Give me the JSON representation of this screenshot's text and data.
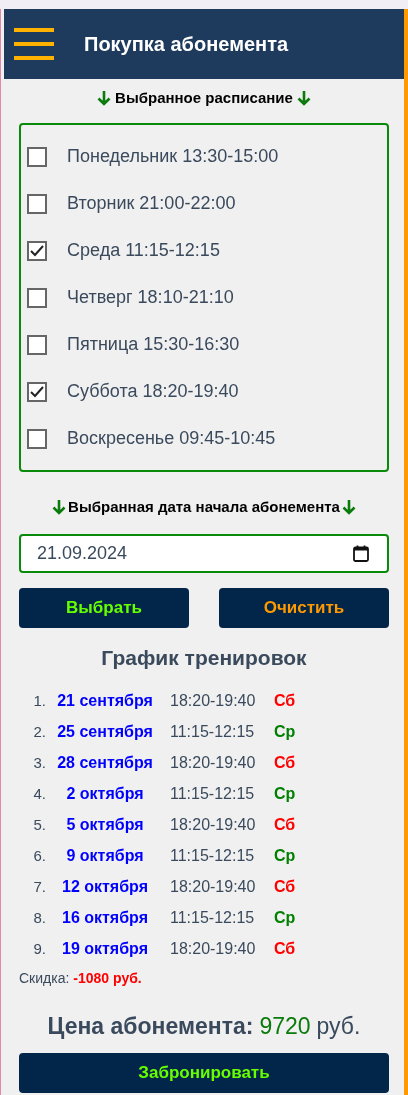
{
  "header": {
    "title": "Покупка абонемента"
  },
  "schedule_section": {
    "heading": "Выбранное расписание",
    "options": [
      {
        "label": "Понедельник 13:30-15:00",
        "checked": false
      },
      {
        "label": "Вторник 21:00-22:00",
        "checked": false
      },
      {
        "label": "Среда 11:15-12:15",
        "checked": true
      },
      {
        "label": "Четверг 18:10-21:10",
        "checked": false
      },
      {
        "label": "Пятница 15:30-16:30",
        "checked": false
      },
      {
        "label": "Суббота 18:20-19:40",
        "checked": true
      },
      {
        "label": "Воскресенье 09:45-10:45",
        "checked": false
      }
    ]
  },
  "date_section": {
    "heading": "Выбранная дата начала абонемента",
    "value": "21.09.2024"
  },
  "buttons": [
    {
      "label": "Выбрать",
      "kind": "select"
    },
    {
      "label": "Очистить",
      "kind": "clear"
    }
  ],
  "plan": {
    "title": "График тренировок",
    "rows": [
      {
        "number": "1.",
        "date": "21 сентября",
        "time": "18:20-19:40",
        "day": "Сб",
        "color": "#ff0000"
      },
      {
        "number": "2.",
        "date": "25 сентября",
        "time": "11:15-12:15",
        "day": "Ср",
        "color": "#008000"
      },
      {
        "number": "3.",
        "date": "28 сентября",
        "time": "18:20-19:40",
        "day": "Сб",
        "color": "#ff0000"
      },
      {
        "number": "4.",
        "date": "2 октября",
        "time": "11:15-12:15",
        "day": "Ср",
        "color": "#008000"
      },
      {
        "number": "5.",
        "date": "5 октября",
        "time": "18:20-19:40",
        "day": "Сб",
        "color": "#ff0000"
      },
      {
        "number": "6.",
        "date": "9 октября",
        "time": "11:15-12:15",
        "day": "Ср",
        "color": "#008000"
      },
      {
        "number": "7.",
        "date": "12 октября",
        "time": "18:20-19:40",
        "day": "Сб",
        "color": "#ff0000"
      },
      {
        "number": "8.",
        "date": "16 октября",
        "time": "11:15-12:15",
        "day": "Ср",
        "color": "#008000"
      },
      {
        "number": "9.",
        "date": "19 октября",
        "time": "18:20-19:40",
        "day": "Сб",
        "color": "#ff0000"
      }
    ]
  },
  "discount": {
    "label": "Скидка:",
    "value": "-1080 руб."
  },
  "price": {
    "label": "Цена абонемента:",
    "amount": "9720",
    "currency": "руб."
  },
  "book_button": {
    "label": "Забронировать"
  }
}
